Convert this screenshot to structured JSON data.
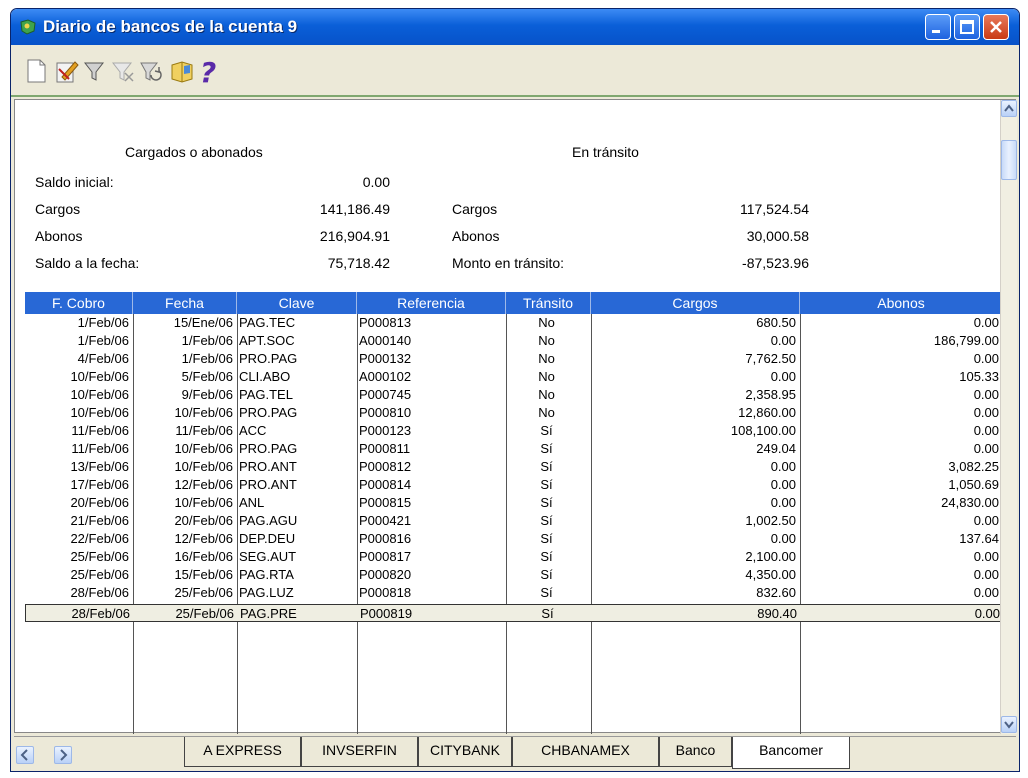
{
  "window": {
    "title": "Diario de bancos de la cuenta 9"
  },
  "summary": {
    "left_header": "Cargados o abonados",
    "right_header": "En tránsito",
    "saldo_inicial_label": "Saldo inicial:",
    "saldo_inicial_value": "0.00",
    "cargos_label": "Cargos",
    "cargos_value": "141,186.49",
    "abonos_label": "Abonos",
    "abonos_value": "216,904.91",
    "saldo_fecha_label": "Saldo a la fecha:",
    "saldo_fecha_value": "75,718.42",
    "transito_cargos_label": "Cargos",
    "transito_cargos_value": "117,524.54",
    "transito_abonos_label": "Abonos",
    "transito_abonos_value": "30,000.58",
    "monto_label": "Monto en tránsito:",
    "monto_value": "-87,523.96"
  },
  "table": {
    "headers": [
      "F. Cobro",
      "Fecha",
      "Clave",
      "Referencia",
      "Tránsito",
      "Cargos",
      "Abonos"
    ],
    "rows": [
      [
        "1/Feb/06",
        "15/Ene/06",
        "PAG.TEC",
        "P000813",
        "No",
        "680.50",
        "0.00"
      ],
      [
        "1/Feb/06",
        "1/Feb/06",
        "APT.SOC",
        "A000140",
        "No",
        "0.00",
        "186,799.00"
      ],
      [
        "4/Feb/06",
        "1/Feb/06",
        "PRO.PAG",
        "P000132",
        "No",
        "7,762.50",
        "0.00"
      ],
      [
        "10/Feb/06",
        "5/Feb/06",
        "CLI.ABO",
        "A000102",
        "No",
        "0.00",
        "105.33"
      ],
      [
        "10/Feb/06",
        "9/Feb/06",
        "PAG.TEL",
        "P000745",
        "No",
        "2,358.95",
        "0.00"
      ],
      [
        "10/Feb/06",
        "10/Feb/06",
        "PRO.PAG",
        "P000810",
        "No",
        "12,860.00",
        "0.00"
      ],
      [
        "11/Feb/06",
        "11/Feb/06",
        "ACC",
        "P000123",
        "Sí",
        "108,100.00",
        "0.00"
      ],
      [
        "11/Feb/06",
        "10/Feb/06",
        "PRO.PAG",
        "P000811",
        "Sí",
        "249.04",
        "0.00"
      ],
      [
        "13/Feb/06",
        "10/Feb/06",
        "PRO.ANT",
        "P000812",
        "Sí",
        "0.00",
        "3,082.25"
      ],
      [
        "17/Feb/06",
        "12/Feb/06",
        "PRO.ANT",
        "P000814",
        "Sí",
        "0.00",
        "1,050.69"
      ],
      [
        "20/Feb/06",
        "10/Feb/06",
        "ANL",
        "P000815",
        "Sí",
        "0.00",
        "24,830.00"
      ],
      [
        "21/Feb/06",
        "20/Feb/06",
        "PAG.AGU",
        "P000421",
        "Sí",
        "1,002.50",
        "0.00"
      ],
      [
        "22/Feb/06",
        "12/Feb/06",
        "DEP.DEU",
        "P000816",
        "Sí",
        "0.00",
        "137.64"
      ],
      [
        "25/Feb/06",
        "16/Feb/06",
        "SEG.AUT",
        "P000817",
        "Sí",
        "2,100.00",
        "0.00"
      ],
      [
        "25/Feb/06",
        "15/Feb/06",
        "PAG.RTA",
        "P000820",
        "Sí",
        "4,350.00",
        "0.00"
      ],
      [
        "28/Feb/06",
        "25/Feb/06",
        "PAG.LUZ",
        "P000818",
        "Sí",
        "832.60",
        "0.00"
      ],
      [
        "28/Feb/06",
        "25/Feb/06",
        "PAG.PRE",
        "P000819",
        "Sí",
        "890.40",
        "0.00"
      ]
    ]
  },
  "tabs": [
    "A EXPRESS",
    "INVSERFIN",
    "CITYBANK",
    "CHBANAMEX",
    "Banco",
    "Bancomer"
  ],
  "active_tab": "Bancomer",
  "colors": {
    "title_bar": "#0a5fd8",
    "header_bg": "#2868d6",
    "close_button": "#c93a14"
  }
}
